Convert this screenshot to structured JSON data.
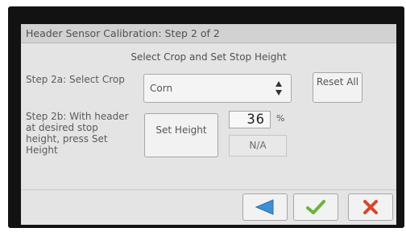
{
  "window": {
    "title": "Header Sensor Calibration:  Step 2 of 2",
    "subtitle": "Select Crop and Set Stop Height"
  },
  "step2a": {
    "label": "Step 2a:  Select Crop",
    "crop_select": {
      "selected_value": "Corn",
      "arrow_icon": "up-down-arrows-icon"
    },
    "reset_button_label": "Reset All"
  },
  "step2b": {
    "label": "Step 2b:  With header at desired stop height, press Set Height",
    "set_height_button_label": "Set Height",
    "height_value": "36",
    "height_unit": "%",
    "secondary_value": "N/A"
  },
  "nav": {
    "back_icon": "back-arrow-icon",
    "accept_icon": "checkmark-icon",
    "cancel_icon": "close-x-icon"
  },
  "colors": {
    "back_arrow": "#3d8fd6",
    "checkmark": "#6cb33f",
    "cancel_x": "#d9452b"
  }
}
